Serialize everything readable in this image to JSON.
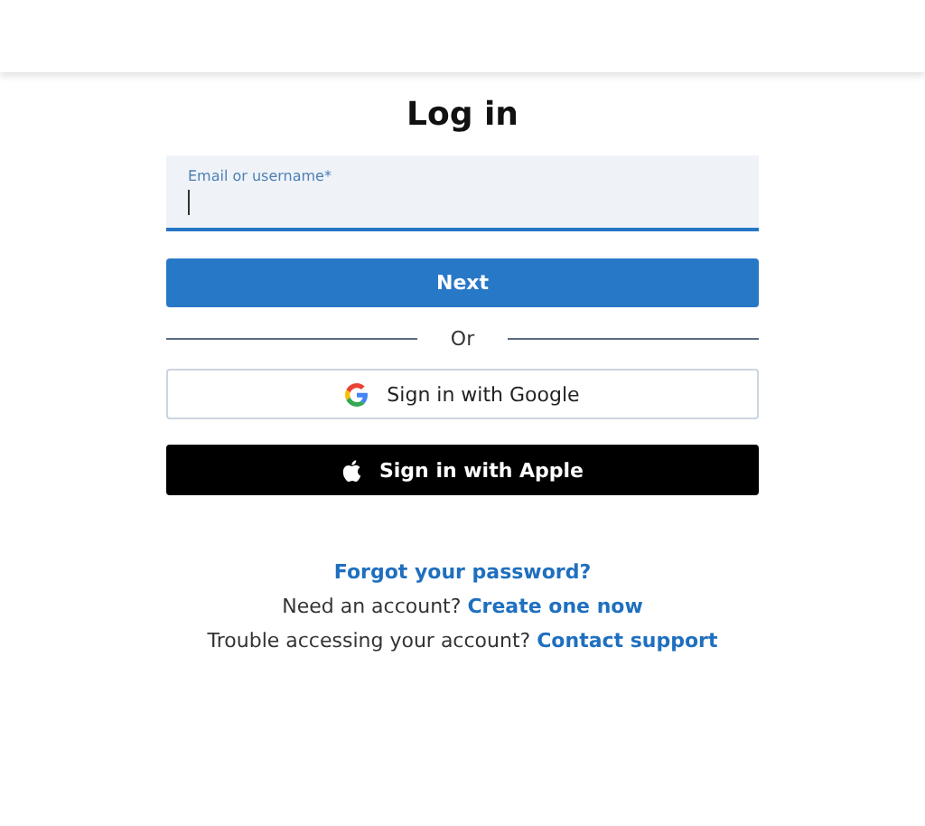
{
  "title": "Log in",
  "email_field": {
    "label": "Email or username*",
    "focused": true
  },
  "next_button": "Next",
  "divider": "Or",
  "providers": [
    {
      "kind": "google",
      "label": "Sign in with Google"
    },
    {
      "kind": "apple",
      "label": "Sign in with Apple"
    }
  ],
  "links": [
    {
      "link": "Forgot your password?"
    },
    {
      "text": "Need an account?",
      "link": "Create one now"
    },
    {
      "text": "Trouble accessing your account?",
      "link": "Contact support"
    }
  ]
}
